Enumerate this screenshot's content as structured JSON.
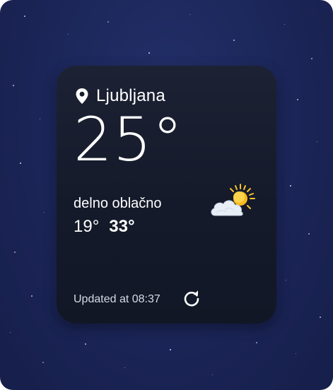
{
  "widget": {
    "location": "Ljubljana",
    "current_temp": "25°",
    "condition": "delno oblačno",
    "temp_min": "19°",
    "temp_max": "33°",
    "updated_text": "Updated at 08:37",
    "icons": {
      "location": "location-pin-icon",
      "weather": "partly-cloudy-icon",
      "refresh": "refresh-icon"
    }
  },
  "colors": {
    "background": "#1b2557",
    "card": "#171d2d",
    "text": "#ffffff",
    "sun": "#f7c32e",
    "cloud": "#e8eef6"
  }
}
